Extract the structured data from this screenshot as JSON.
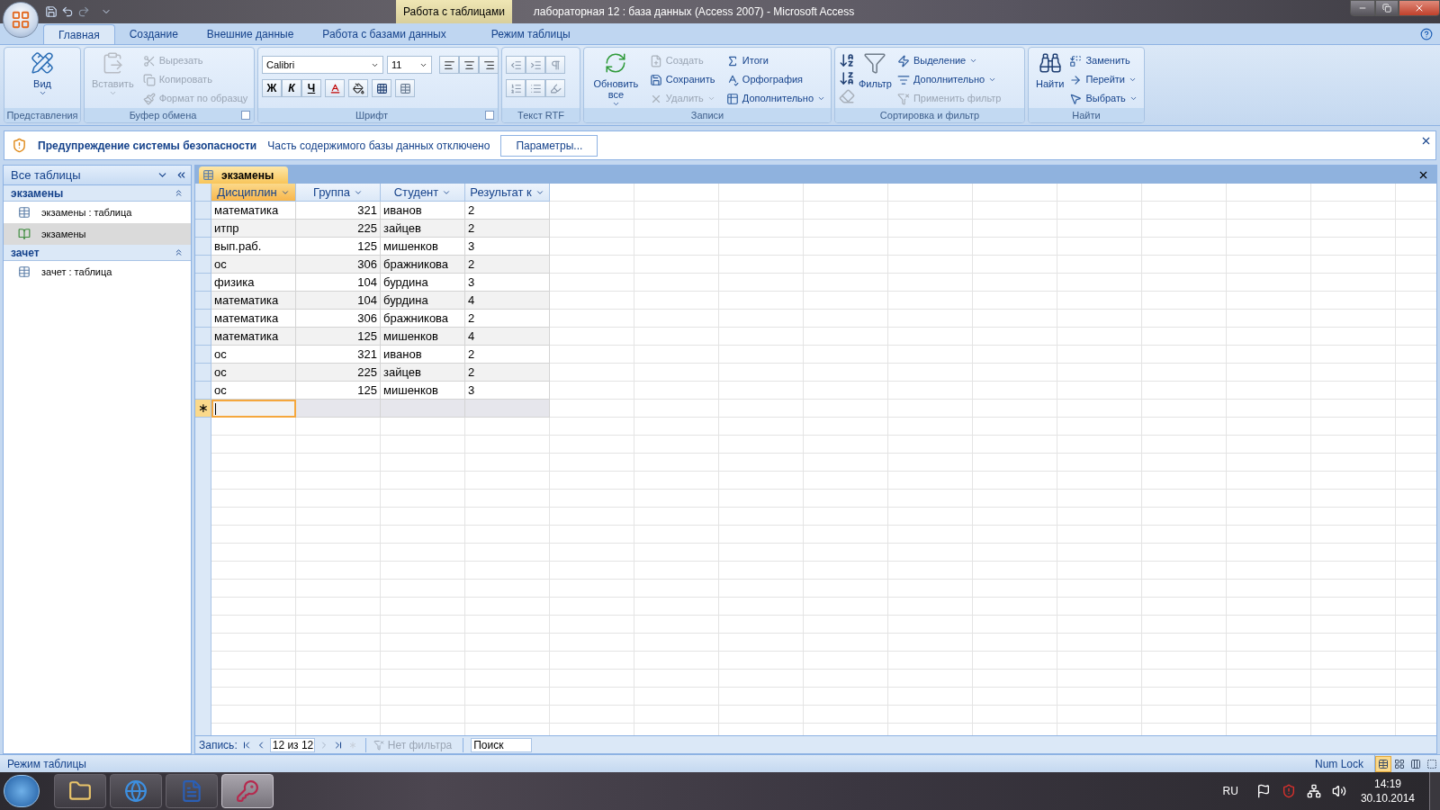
{
  "title_bar": {
    "context_tab": "Работа с таблицами",
    "title": "лабораторная 12 : база данных (Access 2007)  -  Microsoft Access"
  },
  "ribbon_tabs": [
    {
      "label": "Главная",
      "selected": true
    },
    {
      "label": "Создание",
      "selected": false
    },
    {
      "label": "Внешние данные",
      "selected": false
    },
    {
      "label": "Работа с базами данных",
      "selected": false
    },
    {
      "label": "Режим таблицы",
      "selected": false
    }
  ],
  "groups": {
    "views": {
      "label": "Представления",
      "button": {
        "label": "Вид",
        "disabled": false
      }
    },
    "clipboard": {
      "label": "Буфер обмена",
      "launcher": true,
      "paste": {
        "label": "Вставить",
        "disabled": true
      },
      "items": [
        {
          "label": "Вырезать",
          "disabled": true
        },
        {
          "label": "Копировать",
          "disabled": true
        },
        {
          "label": "Формат по образцу",
          "disabled": true
        }
      ]
    },
    "font": {
      "label": "Шрифт",
      "launcher": true,
      "font_name": "Calibri",
      "font_size": "11",
      "format_buttons": [
        "Ж",
        "К",
        "Ч"
      ]
    },
    "rtf": {
      "label": "Текст RTF"
    },
    "records": {
      "label": "Записи",
      "refresh": {
        "label": "Обновить все",
        "disabled": false
      },
      "items": [
        {
          "label": "Создать",
          "disabled": true,
          "dropdown": false
        },
        {
          "label": "Сохранить",
          "disabled": false,
          "dropdown": false
        },
        {
          "label": "Удалить",
          "disabled": true,
          "dropdown": true
        },
        {
          "label": "Итоги",
          "disabled": false,
          "dropdown": false
        },
        {
          "label": "Орфография",
          "disabled": false,
          "dropdown": false
        },
        {
          "label": "Дополнительно",
          "disabled": false,
          "dropdown": true
        }
      ]
    },
    "sort": {
      "label": "Сортировка и фильтр",
      "filter": {
        "label": "Фильтр",
        "disabled": false
      },
      "items": [
        {
          "label": "Выделение",
          "disabled": false,
          "dropdown": true
        },
        {
          "label": "Дополнительно",
          "disabled": false,
          "dropdown": true
        },
        {
          "label": "Применить фильтр",
          "disabled": true,
          "dropdown": false
        }
      ]
    },
    "find": {
      "label": "Найти",
      "find": {
        "label": "Найти",
        "disabled": false
      },
      "items": [
        {
          "label": "Заменить",
          "disabled": false,
          "dropdown": false
        },
        {
          "label": "Перейти",
          "disabled": false,
          "dropdown": true
        },
        {
          "label": "Выбрать",
          "disabled": false,
          "dropdown": true
        }
      ]
    }
  },
  "security_bar": {
    "title": "Предупреждение системы безопасности",
    "message": "Часть содержимого базы данных отключено",
    "button": "Параметры..."
  },
  "nav_pane": {
    "header": "Все таблицы",
    "groups": [
      {
        "label": "экзамены",
        "items": [
          {
            "label": "экзамены : таблица",
            "kind": "table",
            "selected": false
          },
          {
            "label": "экзамены",
            "kind": "form",
            "selected": true
          }
        ]
      },
      {
        "label": "зачет",
        "items": [
          {
            "label": "зачет : таблица",
            "kind": "table",
            "selected": false
          }
        ]
      }
    ]
  },
  "document_tab": {
    "label": "экзамены"
  },
  "table": {
    "columns": [
      {
        "label": "Дисциплин",
        "kind": "text",
        "selected": true
      },
      {
        "label": "Группа",
        "kind": "number",
        "selected": false
      },
      {
        "label": "Студент",
        "kind": "text",
        "selected": false
      },
      {
        "label": "Результат к",
        "kind": "text",
        "selected": false
      }
    ],
    "rows": [
      [
        "математика",
        "321",
        "иванов",
        "2"
      ],
      [
        "итпр",
        "225",
        "зайцев",
        "2"
      ],
      [
        "вып.раб.",
        "125",
        "мишенков",
        "3"
      ],
      [
        "ос",
        "306",
        "бражникова",
        "2"
      ],
      [
        "физика",
        "104",
        "бурдина",
        "3"
      ],
      [
        "математика",
        "104",
        "бурдина",
        "4"
      ],
      [
        "математика",
        "306",
        "бражникова",
        "2"
      ],
      [
        "математика",
        "125",
        "мишенков",
        "4"
      ],
      [
        "ос",
        "321",
        "иванов",
        "2"
      ],
      [
        "ос",
        "225",
        "зайцев",
        "2"
      ],
      [
        "ос",
        "125",
        "мишенков",
        "3"
      ]
    ],
    "new_row_marker": "∗"
  },
  "record_nav": {
    "label": "Запись:",
    "position": "12 из 12",
    "filter": "Нет фильтра",
    "search": "Поиск"
  },
  "status_bar": {
    "mode": "Режим таблицы",
    "num_lock": "Num Lock",
    "views": [
      {
        "selected": true
      },
      {
        "selected": false
      },
      {
        "selected": false
      },
      {
        "selected": false
      }
    ]
  },
  "taskbar": {
    "apps": [
      {
        "selected": false
      },
      {
        "selected": false
      },
      {
        "selected": false
      },
      {
        "selected": true
      }
    ],
    "language": "RU",
    "time": "14:19",
    "date": "30.10.2014"
  }
}
